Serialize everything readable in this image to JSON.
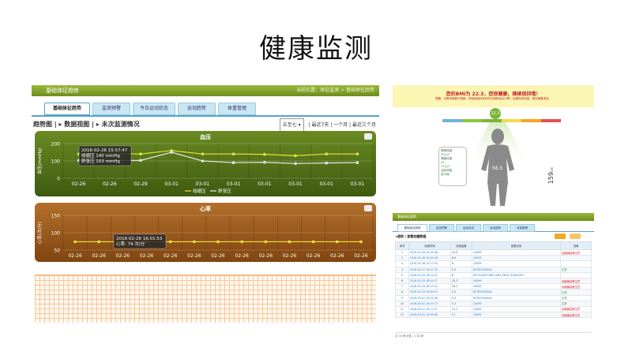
{
  "slide_title": "健康监测",
  "left_panel": {
    "header": "基础体征趋势",
    "breadcrumb": "当前位置：体征监测 > 基础体征趋势",
    "tabs": [
      "基础体征趋势",
      "监测预警",
      "今日运动状态",
      "运动趋势",
      "体重管理"
    ],
    "subbar_left": "趋势图 | ▸ 数据视图 | ▸ 未次监测情况",
    "select_value": "五至七",
    "range_links": [
      "最近7天",
      "一个月",
      "最近三个月"
    ]
  },
  "bp_chart": {
    "title": "血压",
    "ylabel": "血压(mmHg)",
    "tooltip": [
      "2016-02-26 15:57:47",
      "收缩压 140 mmHg",
      "舒张压 103 mmHg"
    ],
    "legend": [
      "收缩压",
      "舒张压"
    ]
  },
  "hr_chart": {
    "title": "心率",
    "ylabel": "心率(次/分)",
    "tooltip": [
      "2016-02-26 16:01:53",
      "心率: 74 次/分"
    ]
  },
  "chart_data": [
    {
      "type": "line",
      "title": "血压",
      "ylabel": "血压(mmHg)",
      "xlabel": "",
      "categories": [
        "02-26",
        "02-26",
        "02-29",
        "03-01",
        "03-01",
        "03-01",
        "03-01",
        "03-01",
        "03-01",
        "03-01"
      ],
      "ylim": [
        0,
        200
      ],
      "yticks": [
        0,
        100,
        200
      ],
      "series": [
        {
          "name": "收缩压",
          "color": "#e8e23a",
          "values": [
            140,
            142,
            140,
            160,
            140,
            140,
            138,
            130,
            140,
            140
          ]
        },
        {
          "name": "舒张压",
          "color": "#e6e6e6",
          "values": [
            103,
            103,
            103,
            150,
            100,
            90,
            92,
            85,
            88,
            90
          ]
        }
      ],
      "grid": true,
      "legend": "bottom"
    },
    {
      "type": "line",
      "title": "心率",
      "ylabel": "心率(次/分)",
      "xlabel": "",
      "categories": [
        "02-26",
        "02-26",
        "02-26",
        "02-26",
        "02-26",
        "02-26",
        "02-26",
        "02-26",
        "02-26",
        "02-26",
        "02-26",
        "02-26",
        "02-26"
      ],
      "ylim": [
        50,
        150
      ],
      "yticks": [
        50,
        100,
        150
      ],
      "series": [
        {
          "name": "心率",
          "color": "#f2e23a",
          "values": [
            74,
            74,
            74,
            74,
            74,
            74,
            74,
            74,
            74,
            74,
            74,
            74,
            74
          ]
        }
      ],
      "grid": true,
      "legend": "none"
    }
  ],
  "right_panel": {
    "bmi_headline": "您的BMI为 22.3，您很健康，继续保持哦！",
    "bmi_desc": "提醒：无需采取额外措施，请继续保持良好的饮食和运动习惯，定期检测体重，维持健康体态。",
    "bmi_value": "22.3",
    "body_weight": "56.5",
    "height": "159",
    "height_unit": "cm",
    "scale_colors": [
      "#6cb3e0",
      "#8cc63f",
      "#7ab535",
      "#f7d94c",
      "#f5a623",
      "#e94f4f"
    ],
    "bubble": [
      "理想体重:",
      "50公斤",
      "健康体重:",
      "45~",
      "57公斤",
      "当前体重:",
      "适中哦！"
    ],
    "table": {
      "header": "基础体征趋势",
      "tabs": [
        "基础体征趋势",
        "监测预警",
        "运动状态",
        "运动趋势",
        "体重管理"
      ],
      "subtitle": "▸趋势 | 查看血糖数据",
      "columns": [
        "序号",
        "测量时间",
        "测量结果",
        "医嘱记录",
        "说明"
      ],
      "rows": [
        [
          "1",
          "2016-02-26 10:05:06",
          "44.8",
          "10099",
          "血糖偏高需注意",
          "red"
        ],
        [
          "2",
          "2016-02-26 10:05:28",
          "6.9",
          "10099",
          "",
          ""
        ],
        [
          "3",
          "2016-02-26 15:27:52",
          "6",
          "10099",
          "",
          ""
        ],
        [
          "4",
          "2016-02-27 15:07:35",
          "5.3",
          "8E7B52H30A0",
          "正常",
          "green"
        ],
        [
          "5",
          "2016-02-29 18:14:47",
          "6",
          "8E7FD4EFF38B C8D5 F8DA 7D4B7DFF...",
          "",
          ""
        ],
        [
          "6",
          "2016-02-29 18:44:17",
          "20.3",
          "10099",
          "血糖偏高需注意",
          "red"
        ],
        [
          "7",
          "2016-02-29 18:57:01",
          "20.2",
          "10099",
          "血糖偏高需注意",
          "red"
        ],
        [
          "8",
          "2016-02-29 19:00:51",
          "4.2",
          "8E7B52H30A0",
          "正常",
          "green"
        ],
        [
          "9",
          "2016-03-01 10:01:36",
          "5.1",
          "8E7B52H30A0",
          "正常",
          "green"
        ],
        [
          "10",
          "2016-03-01 10:07:17",
          "5.1",
          "10099",
          "正常",
          "green"
        ],
        [
          "11",
          "2016-03-01 10:12:57",
          "12.3",
          "10099",
          "血糖偏高需注意",
          "red"
        ],
        [
          "12",
          "2016-03-01 10:05:00",
          "11",
          "10099",
          "血糖偏高需注意",
          "red"
        ]
      ],
      "pager": "共 30 条记录 | 1 共3页"
    }
  }
}
